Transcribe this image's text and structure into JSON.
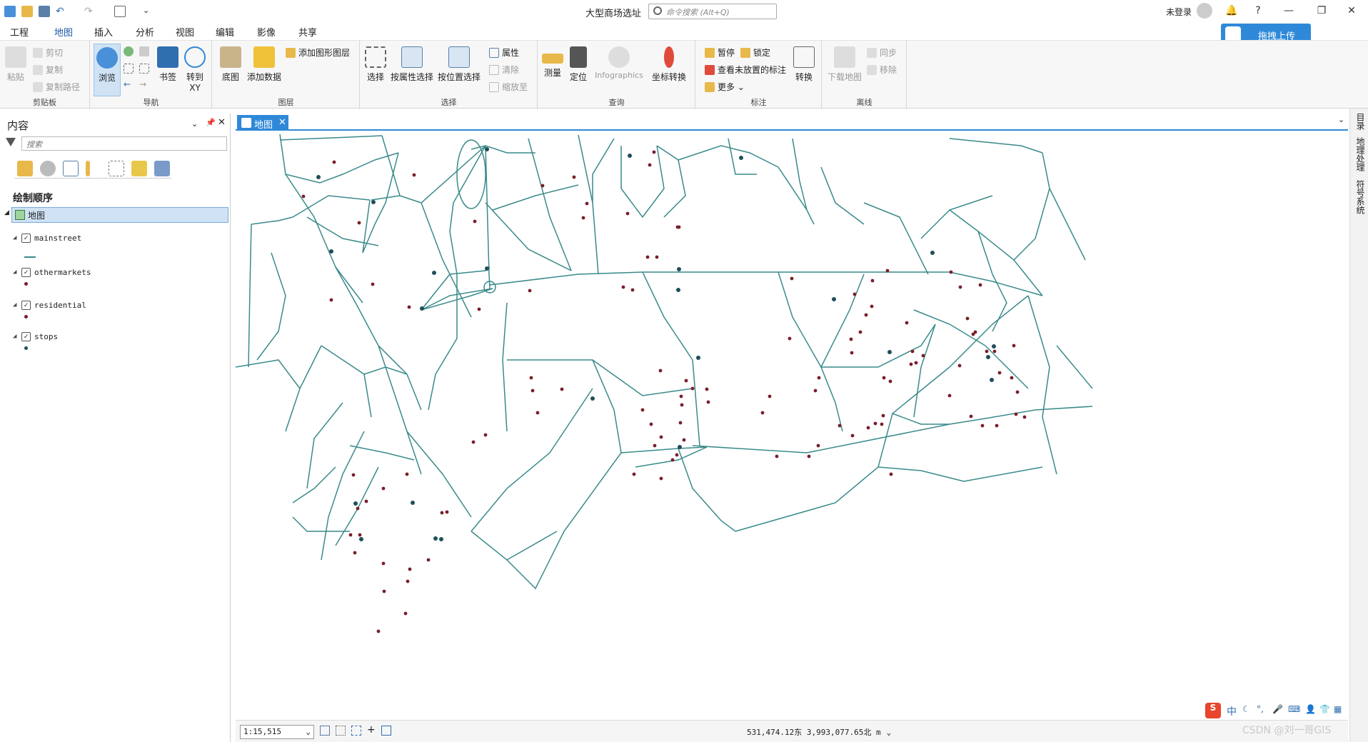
{
  "app": {
    "title": "大型商场选址",
    "command_search_placeholder": "命令搜索 (Alt+Q)",
    "login": "未登录"
  },
  "menu_tabs": [
    "工程",
    "地图",
    "插入",
    "分析",
    "视图",
    "编辑",
    "影像",
    "共享"
  ],
  "upload_button": "拖拽上传",
  "ribbon": {
    "clipboard": {
      "title": "剪贴板",
      "paste": "粘贴",
      "cut": "剪切",
      "copy": "复制",
      "copy_path": "复制路径"
    },
    "navigate": {
      "title": "导航",
      "explore": "浏览",
      "bookmarks": "书签",
      "goto": "转到\nXY"
    },
    "layer": {
      "title": "图层",
      "basemap": "底图",
      "add_data": "添加数据",
      "add_graphics": "添加图形图层"
    },
    "selection": {
      "title": "选择",
      "select": "选择",
      "by_attr": "按属性选择",
      "by_loc": "按位置选择",
      "attributes": "属性",
      "clear": "清除",
      "zoom_to": "缩放至"
    },
    "inquiry": {
      "title": "查询",
      "measure": "测量",
      "locate": "定位",
      "infographics": "Infographics",
      "coord_convert": "坐标转换"
    },
    "labeling": {
      "title": "标注",
      "pause": "暂停",
      "lock": "锁定",
      "view_unplaced": "查看未放置的标注",
      "more": "更多",
      "convert": "转换"
    },
    "offline": {
      "title": "离线",
      "download": "下载地图",
      "sync": "同步",
      "remove": "移除"
    }
  },
  "contents": {
    "title": "内容",
    "search_placeholder": "搜索",
    "draw_order": "绘制顺序",
    "map_name": "地图",
    "layers": [
      {
        "name": "mainstreet",
        "symbol": "line",
        "color": "#3a8a8a"
      },
      {
        "name": "othermarkets",
        "symbol": "point",
        "color": "#7a1f2b"
      },
      {
        "name": "residential",
        "symbol": "point",
        "color": "#7a1f2b"
      },
      {
        "name": "stops",
        "symbol": "point",
        "color": "#1f4f5a"
      }
    ]
  },
  "map_tab": "地图",
  "right_panels": [
    "目录",
    "地理处理",
    "符号系统"
  ],
  "status": {
    "scale": "1:15,515",
    "coordinates": "531,474.12东 3,993,077.65北 m"
  },
  "watermark": "CSDN @刘一哥GIS",
  "colors": {
    "street": "#3a8a8a",
    "market": "#7a1f2b",
    "stop": "#1f4f5a",
    "accent": "#2f89d9"
  }
}
